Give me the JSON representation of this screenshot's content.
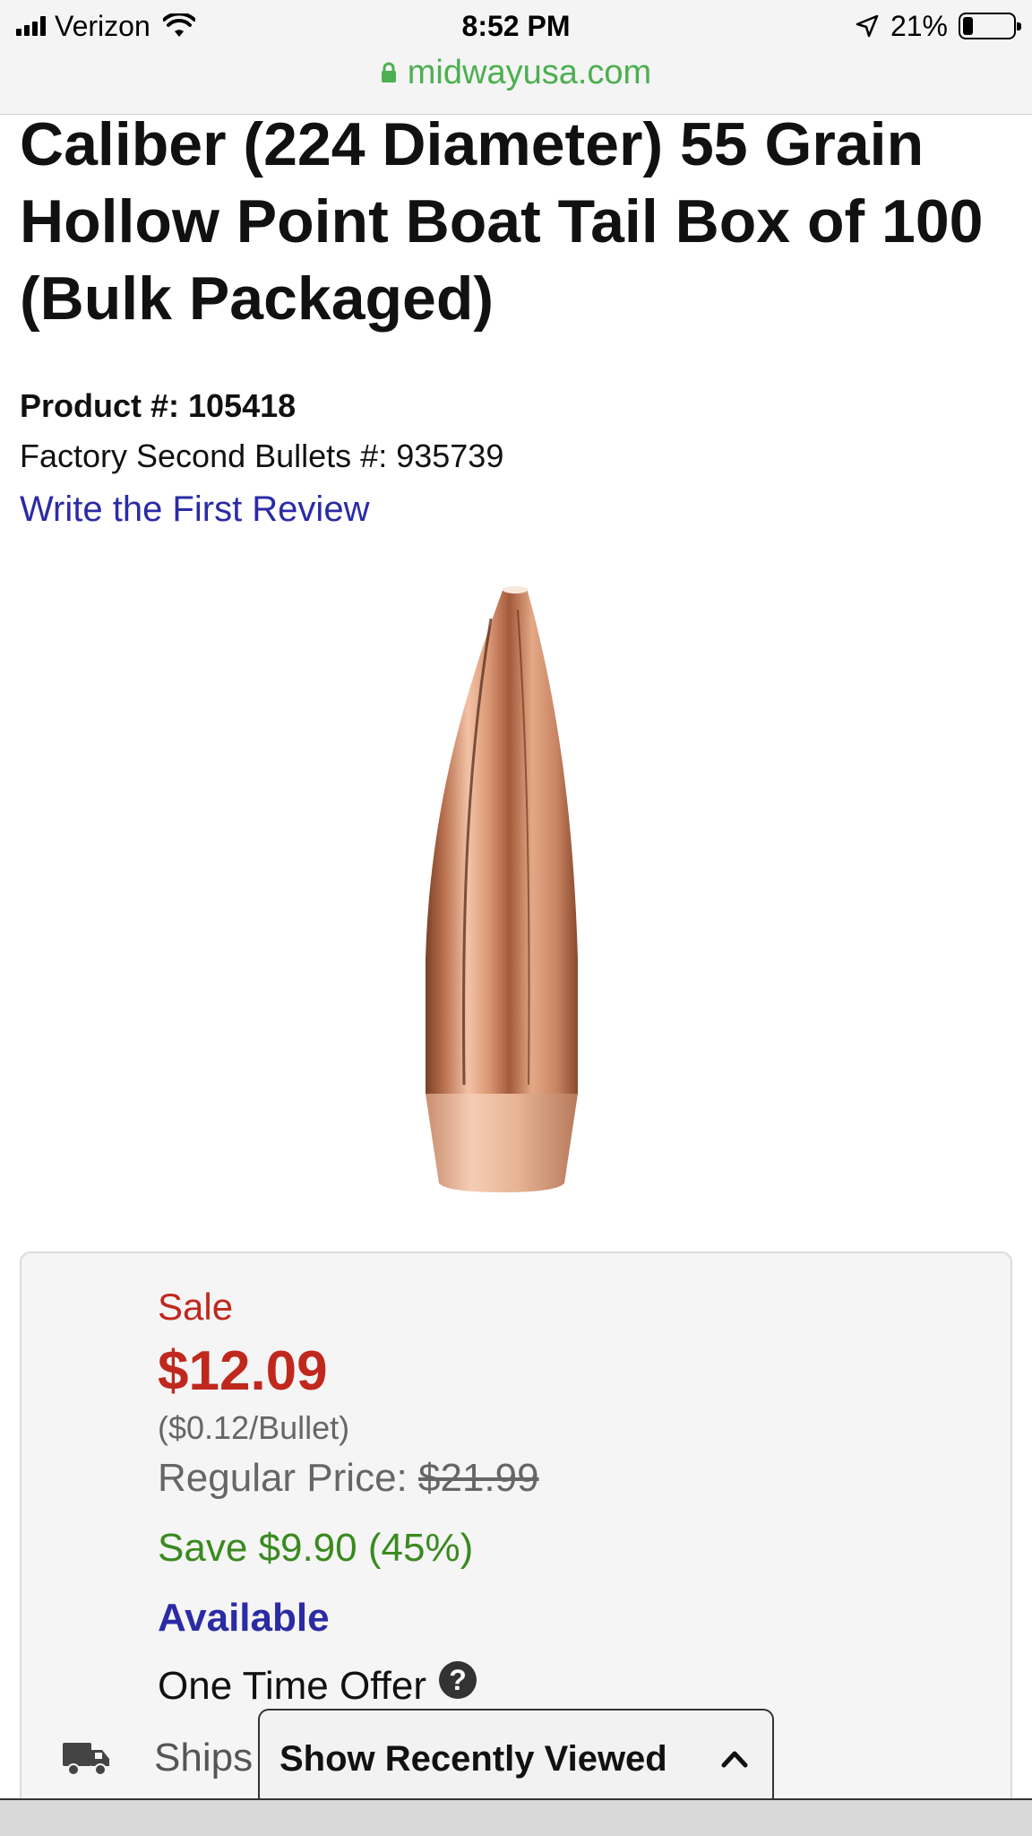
{
  "status_bar": {
    "carrier": "Verizon",
    "time": "8:52 PM",
    "battery_percent": "21%",
    "battery_level": 0.21,
    "url": "midwayusa.com"
  },
  "product": {
    "title": "Caliber (224 Diameter) 55 Grain Hollow Point Boat Tail Box of 100 (Bulk Packaged)",
    "product_number": "Product #: 105418",
    "factory_second": "Factory Second Bullets #: 935739",
    "review_link": "Write the First Review"
  },
  "pricing": {
    "sale_label": "Sale",
    "price": "$12.09",
    "per_unit": "($0.12/Bullet)",
    "regular_label": "Regular Price: ",
    "regular_price": "$21.99",
    "savings": "Save $9.90 (45%)",
    "availability": "Available",
    "offer": "One Time Offer",
    "ships": "Ships"
  },
  "recently_viewed": {
    "label": "Show Recently Viewed"
  },
  "colors": {
    "sale_red": "#c0281e",
    "link_blue": "#2b2ba5",
    "save_green": "#3a8a1f",
    "url_green": "#4caf50"
  },
  "icons": [
    "signal-icon",
    "wifi-icon",
    "location-arrow-icon",
    "battery-icon",
    "lock-icon",
    "help-icon",
    "truck-icon",
    "chevron-up-icon"
  ]
}
